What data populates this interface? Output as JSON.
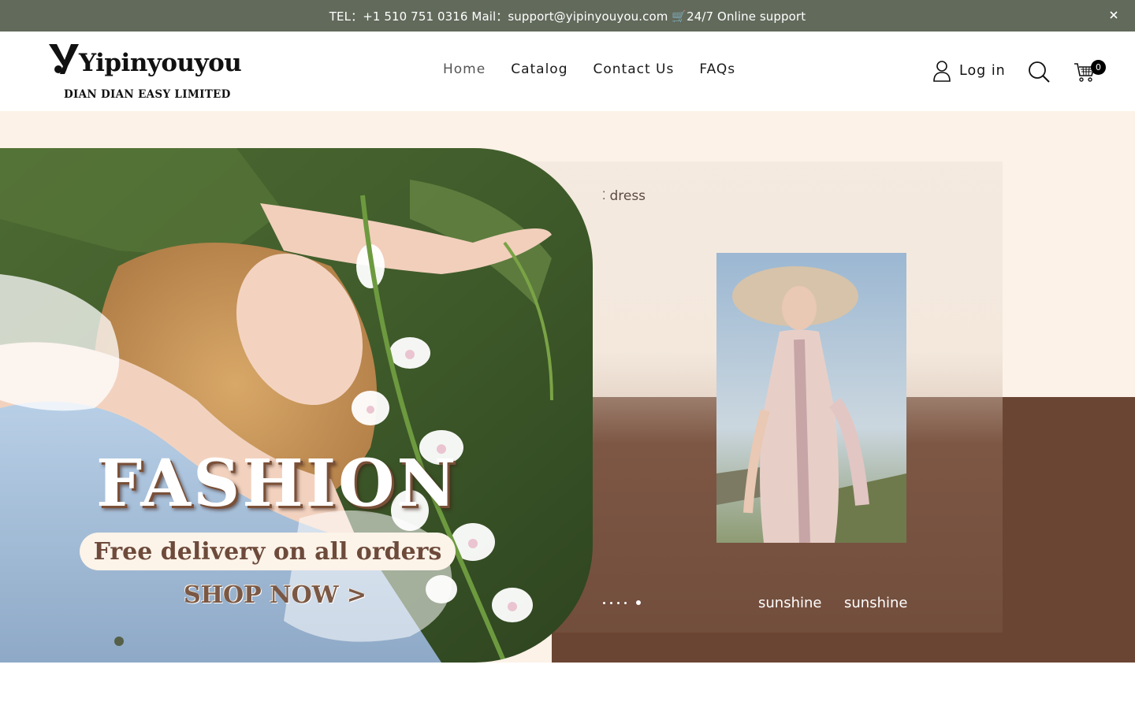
{
  "announcement": {
    "text": "TEL：+1 510 751 0316   Mail：support@yipinyouyou.com   🛒24/7 Online support",
    "close_icon": "close-icon"
  },
  "header": {
    "logo": {
      "brand": "Yipinyouyou",
      "subtitle": "DIAN DIAN EASY LIMITED"
    },
    "nav": [
      {
        "label": "Home",
        "active": true
      },
      {
        "label": "Catalog"
      },
      {
        "label": "Contact Us"
      },
      {
        "label": "FAQs"
      }
    ],
    "login_label": "Log in",
    "cart_count": "0",
    "icons": [
      "user-icon",
      "search-icon",
      "cart-icon"
    ]
  },
  "hero": {
    "headline": "FASHION",
    "tagline": "Free delivery on all orders",
    "cta": "SHOP NOW >",
    "panel_label": "dress",
    "captions": [
      "sunshine",
      "sunshine"
    ],
    "slide_count": 1,
    "colors": {
      "accent_bar": "#626a5b",
      "hero_bg": "#fcf2e7",
      "brown": "#6b4533",
      "slide_dot": "#566048"
    }
  }
}
